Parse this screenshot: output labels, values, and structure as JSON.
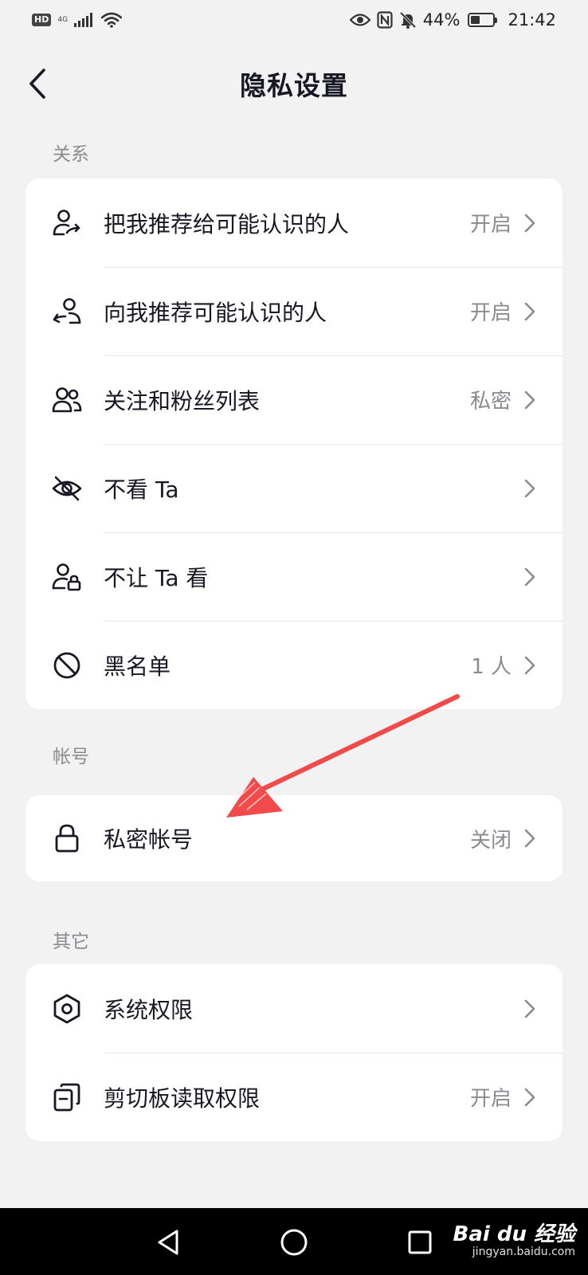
{
  "status_bar": {
    "network_label": "4G",
    "battery_text": "44%",
    "battery_level": 0.44,
    "time": "21:42"
  },
  "header": {
    "title": "隐私设置"
  },
  "sections": [
    {
      "title": "关系",
      "items": [
        {
          "label": "把我推荐给可能认识的人",
          "value": "开启",
          "icon": "person-share-icon"
        },
        {
          "label": "向我推荐可能认识的人",
          "value": "开启",
          "icon": "person-recommend-icon"
        },
        {
          "label": "关注和粉丝列表",
          "value": "私密",
          "icon": "people-icon"
        },
        {
          "label": "不看 Ta",
          "value": "",
          "icon": "eye-off-icon"
        },
        {
          "label": "不让 Ta 看",
          "value": "",
          "icon": "person-lock-icon"
        },
        {
          "label": "黑名单",
          "value": "1 人",
          "icon": "block-icon"
        }
      ]
    },
    {
      "title": "帐号",
      "items": [
        {
          "label": "私密帐号",
          "value": "关闭",
          "icon": "lock-icon"
        }
      ]
    },
    {
      "title": "其它",
      "items": [
        {
          "label": "系统权限",
          "value": "",
          "icon": "hexagon-settings-icon"
        },
        {
          "label": "剪切板读取权限",
          "value": "开启",
          "icon": "clipboard-icon"
        }
      ]
    }
  ],
  "watermark": {
    "brand": "Bai du 经验",
    "url": "jingyan.baidu.com"
  },
  "colors": {
    "background": "#f2f2f2",
    "card": "#ffffff",
    "text_primary": "#161823",
    "text_secondary": "#8a8b91",
    "annotation_arrow": "#f04a4a"
  }
}
